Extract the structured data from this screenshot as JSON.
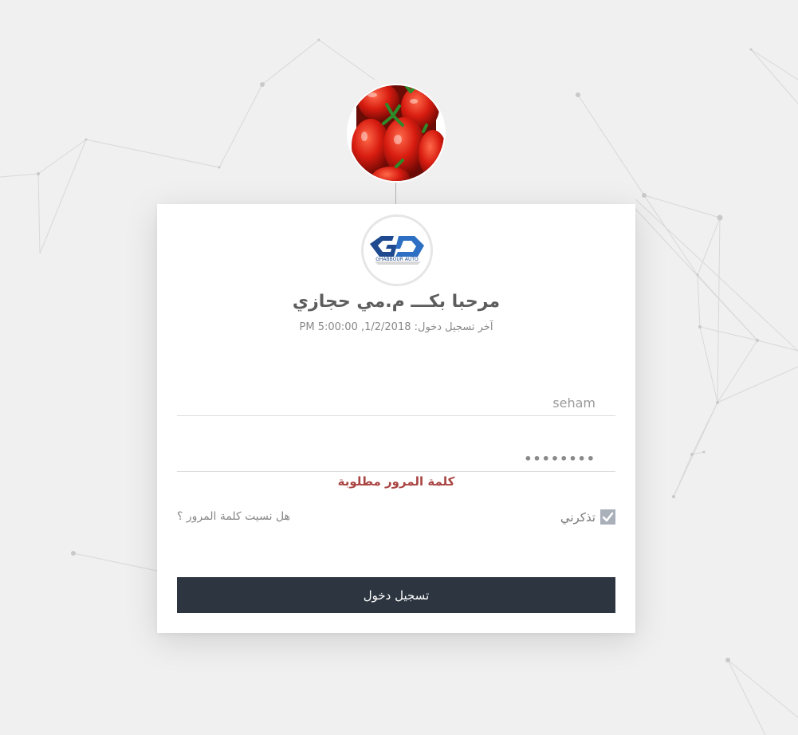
{
  "profile": {
    "avatar_icon": "tomatoes-photo",
    "logo_icon": "ghabbour-auto-logo",
    "logo_text": "GHABBOUR AUTO"
  },
  "welcome": {
    "title": "مرحبا بكـــ م.مي حجازي",
    "last_login": "آخر تسجيل دخول: 1/2/2018, 5:00:00 PM"
  },
  "form": {
    "username_value": "seham",
    "password_value": "••••••••",
    "password_error": "كلمة المرور مطلوبة",
    "remember_label": "تذكرني",
    "remember_checked": true,
    "forgot_label": "هل نسيت كلمة المرور ؟",
    "submit_label": "تسجيل دخول"
  },
  "colors": {
    "background": "#f0f0f0",
    "button": "#2d3540",
    "error": "#a94442",
    "checkbox": "#a9b0ba"
  }
}
